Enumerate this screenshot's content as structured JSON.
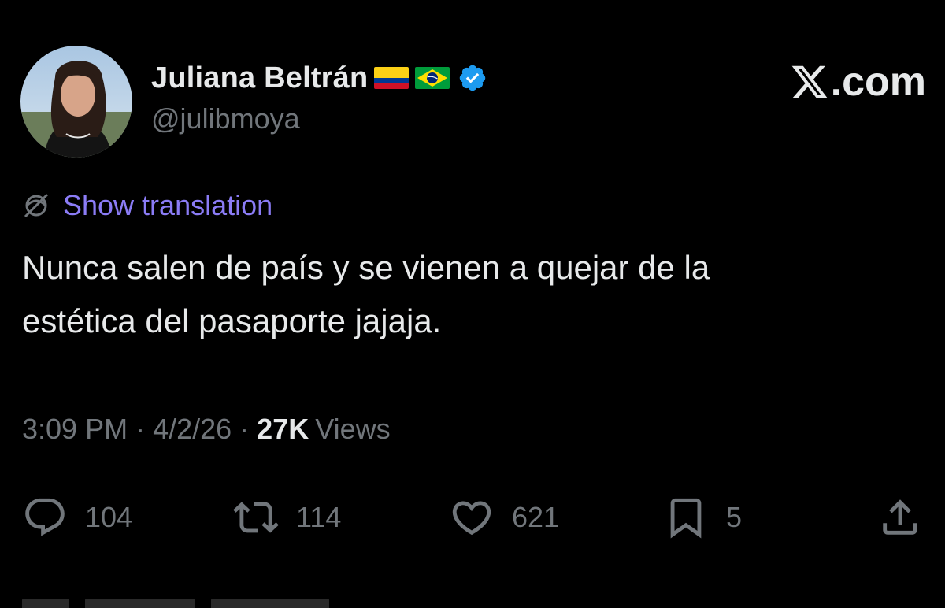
{
  "author": {
    "display_name": "Juliana Beltrán",
    "handle": "@julibmoya",
    "flags": [
      "colombia-flag",
      "brazil-flag"
    ],
    "verified_icon": "verified-badge-icon"
  },
  "brand": {
    "logo_letter": "𝕏",
    "suffix": ".com"
  },
  "translation": {
    "label": "Show translation",
    "icon": "globe-icon"
  },
  "tweet": {
    "text_line_1": "Nunca salen de país y se vienen a quejar de la",
    "text_line_2": "estética del pasaporte jajaja."
  },
  "meta": {
    "time": "3:09 PM",
    "separator": "·",
    "date": "4/2/26",
    "views_count": "27K",
    "views_label": "Views"
  },
  "actions": {
    "replies": "104",
    "reposts": "114",
    "likes": "621",
    "bookmarks": "5"
  },
  "colors": {
    "background": "#000000",
    "primary_text": "#e7e9ea",
    "secondary_text": "#71767b",
    "link": "#8b7cf6",
    "verified": "#1d9bf0"
  }
}
